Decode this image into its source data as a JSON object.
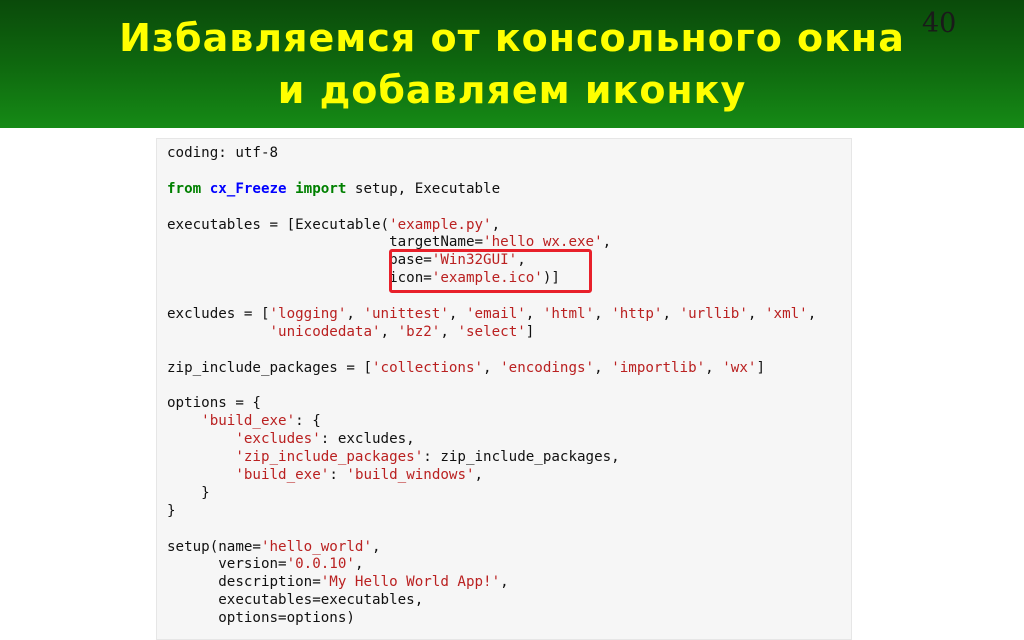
{
  "slide": {
    "title_line1": "Избавляемся от консольного окна",
    "title_line2": "и добавляем иконку",
    "page_number": "40"
  },
  "code": {
    "l1": {
      "a": "coding: utf-8"
    },
    "l3": {
      "kw1": "from",
      "sp1": " ",
      "mod": "cx_Freeze",
      "sp2": " ",
      "kw2": "import",
      "rest": " setup, Executable"
    },
    "l5": {
      "pre": "executables = [Executable(",
      "s1": "'example.py'",
      "post": ","
    },
    "l6": {
      "pre": "                          targetName=",
      "s1": "'hello_wx.exe'",
      "post": ","
    },
    "l7": {
      "pre": "                          base=",
      "s1": "'Win32GUI'",
      "post": ","
    },
    "l8": {
      "pre": "                          icon=",
      "s1": "'example.ico'",
      "post": ")]"
    },
    "l10": {
      "pre": "excludes = [",
      "s1": "'logging'",
      "c1": ", ",
      "s2": "'unittest'",
      "c2": ", ",
      "s3": "'email'",
      "c3": ", ",
      "s4": "'html'",
      "c4": ", ",
      "s5": "'http'",
      "c5": ", ",
      "s6": "'urllib'",
      "c6": ", ",
      "s7": "'xml'",
      "post": ","
    },
    "l11": {
      "pre": "            ",
      "s1": "'unicodedata'",
      "c1": ", ",
      "s2": "'bz2'",
      "c2": ", ",
      "s3": "'select'",
      "post": "]"
    },
    "l13": {
      "pre": "zip_include_packages = [",
      "s1": "'collections'",
      "c1": ", ",
      "s2": "'encodings'",
      "c2": ", ",
      "s3": "'importlib'",
      "c3": ", ",
      "s4": "'wx'",
      "post": "]"
    },
    "l15": {
      "a": "options = {"
    },
    "l16": {
      "pre": "    ",
      "s1": "'build_exe'",
      "post": ": {"
    },
    "l17": {
      "pre": "        ",
      "s1": "'excludes'",
      "post": ": excludes,"
    },
    "l18": {
      "pre": "        ",
      "s1": "'zip_include_packages'",
      "post": ": zip_include_packages,"
    },
    "l19": {
      "pre": "        ",
      "s1": "'build_exe'",
      "c1": ": ",
      "s2": "'build_windows'",
      "post": ","
    },
    "l20": {
      "a": "    }"
    },
    "l21": {
      "a": "}"
    },
    "l23": {
      "pre": "setup(name=",
      "s1": "'hello_world'",
      "post": ","
    },
    "l24": {
      "pre": "      version=",
      "s1": "'0.0.10'",
      "post": ","
    },
    "l25": {
      "pre": "      description=",
      "s1": "'My Hello World App!'",
      "post": ","
    },
    "l26": {
      "a": "      executables=executables,"
    },
    "l27": {
      "a": "      options=options)"
    }
  },
  "colors": {
    "title": "#ffff00",
    "header_green": "#0f6b0f",
    "keyword": "#008000",
    "module": "#0000ff",
    "string": "#ba2121",
    "highlight_box": "#e8202a"
  }
}
